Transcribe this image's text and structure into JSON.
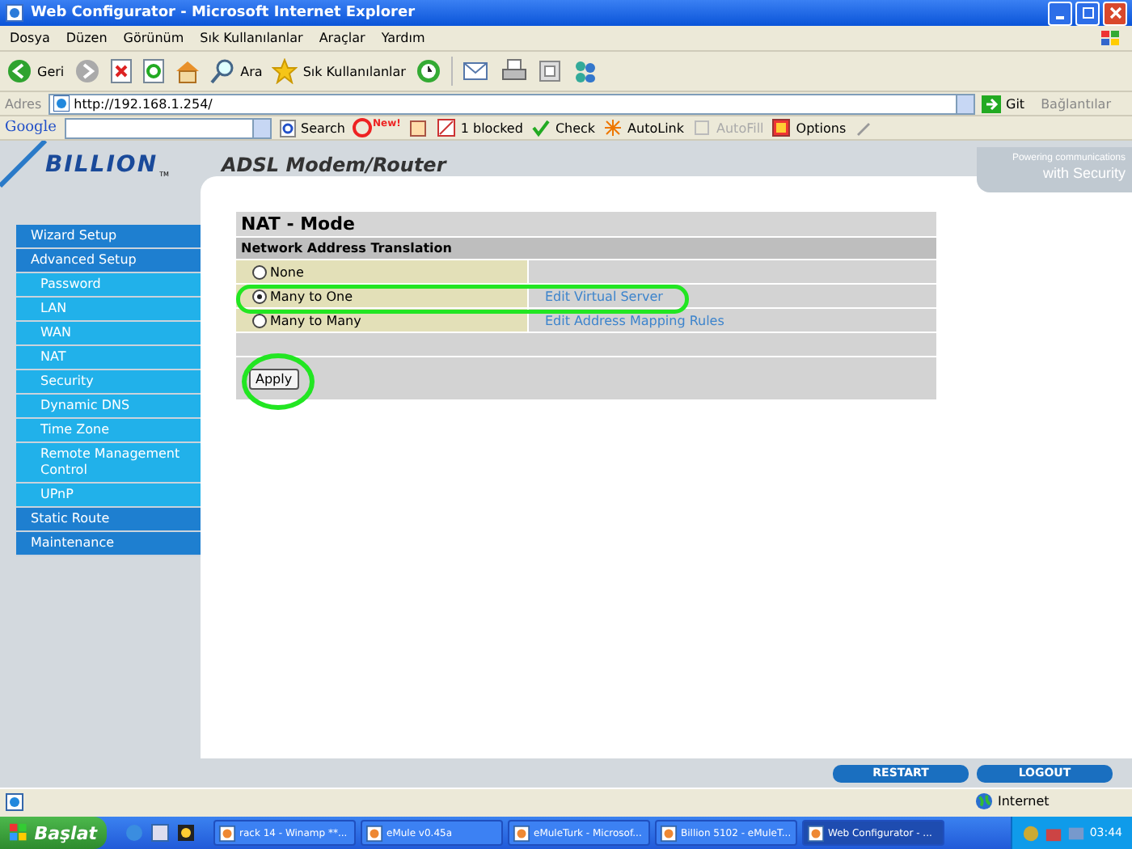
{
  "window": {
    "title": "Web Configurator - Microsoft Internet Explorer"
  },
  "menu": [
    "Dosya",
    "Düzen",
    "Görünüm",
    "Sık Kullanılanlar",
    "Araçlar",
    "Yardım"
  ],
  "toolbar": {
    "back": "Geri",
    "search": "Ara",
    "favorites": "Sık Kullanılanlar"
  },
  "address": {
    "label": "Adres",
    "value": "http://192.168.1.254/",
    "go": "Git",
    "links": "Bağlantılar"
  },
  "google_bar": {
    "logo": "Google",
    "search": "Search",
    "new_badge": "New!",
    "blocked": "1 blocked",
    "check": "Check",
    "autolink": "AutoLink",
    "autofill": "AutoFill",
    "options": "Options"
  },
  "page": {
    "logo": "BILLION",
    "logo_mark": "TM",
    "product": "ADSL Modem/Router",
    "tagline_top": "Powering communications",
    "tagline_bottom": "with Security",
    "sidebar": [
      {
        "label": "Wizard Setup"
      },
      {
        "label": "Advanced Setup",
        "children": [
          {
            "label": "Password"
          },
          {
            "label": "LAN"
          },
          {
            "label": "WAN"
          },
          {
            "label": "NAT"
          },
          {
            "label": "Security"
          },
          {
            "label": "Dynamic DNS"
          },
          {
            "label": "Time Zone"
          },
          {
            "label": "Remote Management Control"
          },
          {
            "label": "UPnP"
          }
        ]
      },
      {
        "label": "Static Route"
      },
      {
        "label": "Maintenance"
      }
    ],
    "panel": {
      "title": "NAT - Mode",
      "section": "Network Address Translation",
      "options": [
        {
          "label": "None",
          "selected": false
        },
        {
          "label": "Many to One",
          "selected": true,
          "link": "Edit Virtual Server"
        },
        {
          "label": "Many to Many",
          "selected": false,
          "link": "Edit Address Mapping Rules"
        }
      ],
      "apply": "Apply"
    },
    "footer_buttons": [
      "RESTART",
      "LOGOUT"
    ]
  },
  "status_bar": {
    "zone": "Internet"
  },
  "taskbar": {
    "start": "Başlat",
    "tasks": [
      {
        "label": "rack 14 - Winamp **...",
        "selected": false
      },
      {
        "label": "eMule v0.45a",
        "selected": false
      },
      {
        "label": "eMuleTurk - Microsof...",
        "selected": false
      },
      {
        "label": "Billion 5102 - eMuleT...",
        "selected": false
      },
      {
        "label": "Web Configurator - ...",
        "selected": true
      }
    ],
    "clock": "03:44"
  }
}
